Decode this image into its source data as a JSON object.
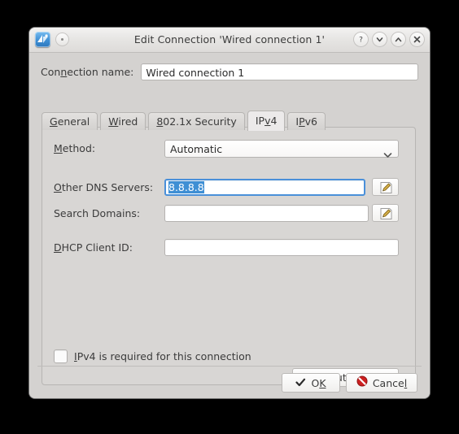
{
  "window": {
    "title": "Edit Connection 'Wired connection 1'",
    "app_icon": "network-connection-icon",
    "menu_button": "window-menu-icon",
    "controls": [
      {
        "name": "help-button",
        "glyph": "?"
      },
      {
        "name": "shade-button",
        "glyph": "v"
      },
      {
        "name": "unshade-button",
        "glyph": "^"
      },
      {
        "name": "close-button",
        "glyph": "x"
      }
    ]
  },
  "connection": {
    "label_pre": "Con",
    "label_mnemonic": "n",
    "label_post": "ection name:",
    "value": "Wired connection 1"
  },
  "tabs": [
    {
      "pre": "",
      "mnemonic": "G",
      "post": "eneral",
      "active": false,
      "name": "tab-general"
    },
    {
      "pre": "",
      "mnemonic": "W",
      "post": "ired",
      "active": false,
      "name": "tab-wired"
    },
    {
      "pre": "",
      "mnemonic": "8",
      "post": "02.1x Security",
      "active": false,
      "name": "tab-8021x-security"
    },
    {
      "pre": "IP",
      "mnemonic": "v",
      "post": "4",
      "active": true,
      "name": "tab-ipv4"
    },
    {
      "pre": "I",
      "mnemonic": "P",
      "post": "v6",
      "active": false,
      "name": "tab-ipv6"
    }
  ],
  "form": {
    "method": {
      "pre": "",
      "mnemonic": "M",
      "post": "ethod:",
      "value": "Automatic",
      "options": [
        "Automatic"
      ]
    },
    "dns": {
      "pre": "",
      "mnemonic": "O",
      "post": "ther DNS Servers:",
      "value": "8.8.8.8",
      "selected": true,
      "edit_icon": "pencil-icon"
    },
    "search_domains": {
      "pre": "",
      "mnemonic": "",
      "post": "Search Domains:",
      "value": "",
      "edit_icon": "pencil-icon"
    },
    "dhcp": {
      "pre": "",
      "mnemonic": "D",
      "post": "HCP Client ID:",
      "value": ""
    },
    "require_ipv4": {
      "pre": "",
      "mnemonic": "I",
      "post": "Pv4 is required for this connection",
      "checked": false
    },
    "routes": {
      "pre": "",
      "mnemonic": "R",
      "post": "outes..."
    }
  },
  "footer": {
    "ok": {
      "pre": "O",
      "mnemonic": "K",
      "post": "",
      "icon": "checkmark-icon"
    },
    "cancel": {
      "pre": "Cance",
      "mnemonic": "l",
      "post": "",
      "icon": "cancel-circle-icon"
    }
  },
  "colors": {
    "window_bg": "#d4d2d0",
    "panel_bg": "#d8d6d4",
    "selection_blue": "#3f8fd4",
    "focus_border": "#4a90d9",
    "cancel_red": "#cc2020",
    "text": "#3b3b3b"
  }
}
